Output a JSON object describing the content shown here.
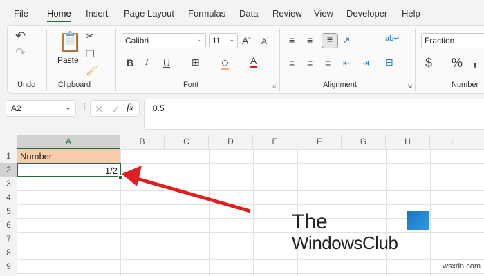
{
  "tabs": [
    {
      "label": "File"
    },
    {
      "label": "Home"
    },
    {
      "label": "Insert"
    },
    {
      "label": "Page Layout"
    },
    {
      "label": "Formulas"
    },
    {
      "label": "Data"
    },
    {
      "label": "Review"
    },
    {
      "label": "View"
    },
    {
      "label": "Developer"
    },
    {
      "label": "Help"
    }
  ],
  "ribbon": {
    "groups": {
      "undo": "Undo",
      "clipboard": "Clipboard",
      "font": "Font",
      "alignment": "Alignment",
      "number": "Number"
    },
    "paste_label": "Paste",
    "font_name": "Calibri",
    "font_size": "11",
    "bold": "B",
    "italic": "I",
    "underline": "U",
    "number_format": "Fraction",
    "currency": "$",
    "percent": "%",
    "comma": ","
  },
  "formula_bar": {
    "name_box": "A2",
    "fx": "fx",
    "value": "0.5"
  },
  "sheet": {
    "columns": [
      "A",
      "B",
      "C",
      "D",
      "E",
      "F",
      "G",
      "H",
      "I"
    ],
    "rows": [
      "1",
      "2",
      "3",
      "4",
      "5",
      "6",
      "7",
      "8",
      "9"
    ],
    "cells": {
      "A1": "Number",
      "A2": "1/2"
    }
  },
  "colors": {
    "accent": "#1e6b3c",
    "header_fill": "#f8cbad",
    "arrow": "#e02020"
  },
  "watermark": {
    "line1": "The",
    "line2": "WindowsClub",
    "site": "wsxdn.com"
  }
}
